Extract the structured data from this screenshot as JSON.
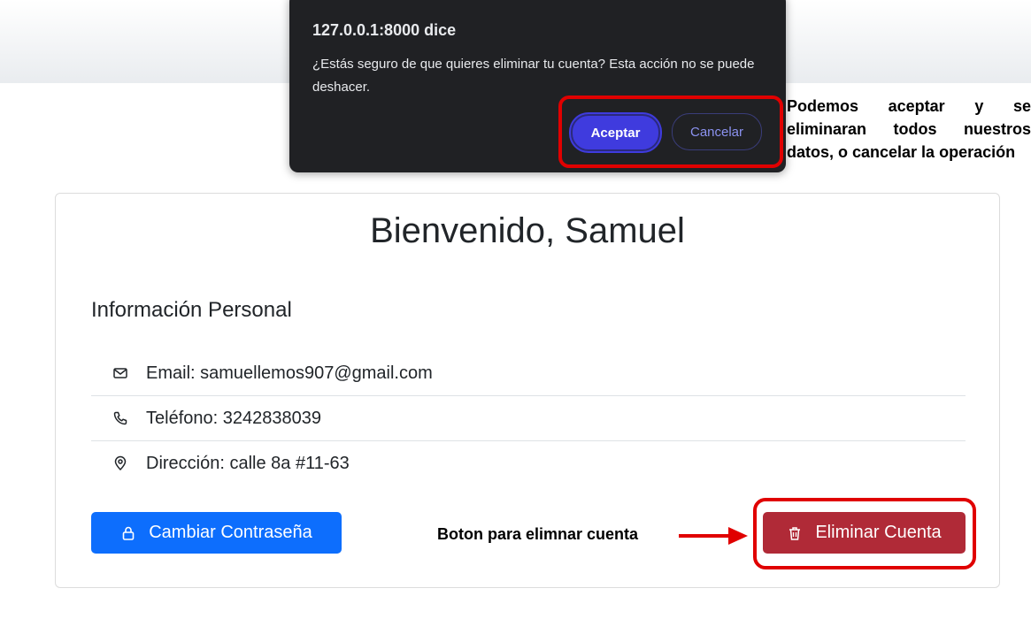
{
  "dialog": {
    "title": "127.0.0.1:8000 dice",
    "message": "¿Estás seguro de que quieres eliminar tu cuenta? Esta acción no se puede deshacer.",
    "ok_label": "Aceptar",
    "cancel_label": "Cancelar"
  },
  "annotations": {
    "dialog_note": "Podemos aceptar y se eliminaran todos nuestros datos, o cancelar la operación",
    "delete_note": "Boton para elimnar cuenta"
  },
  "profile": {
    "welcome": "Bienvenido, Samuel",
    "section_title": "Información Personal",
    "rows": [
      {
        "icon": "envelope-icon",
        "text": "Email: samuellemos907@gmail.com"
      },
      {
        "icon": "phone-icon",
        "text": "Teléfono: 3242838039"
      },
      {
        "icon": "location-pin-icon",
        "text": "Dirección: calle 8a #11-63"
      }
    ],
    "change_password_label": "Cambiar Contraseña",
    "delete_account_label": "Eliminar Cuenta"
  },
  "colors": {
    "primary": "#0d6efd",
    "danger": "#b02a37",
    "dialog_bg": "#202124",
    "dialog_accent": "#3f3bde",
    "annotation_red": "#e00000"
  }
}
